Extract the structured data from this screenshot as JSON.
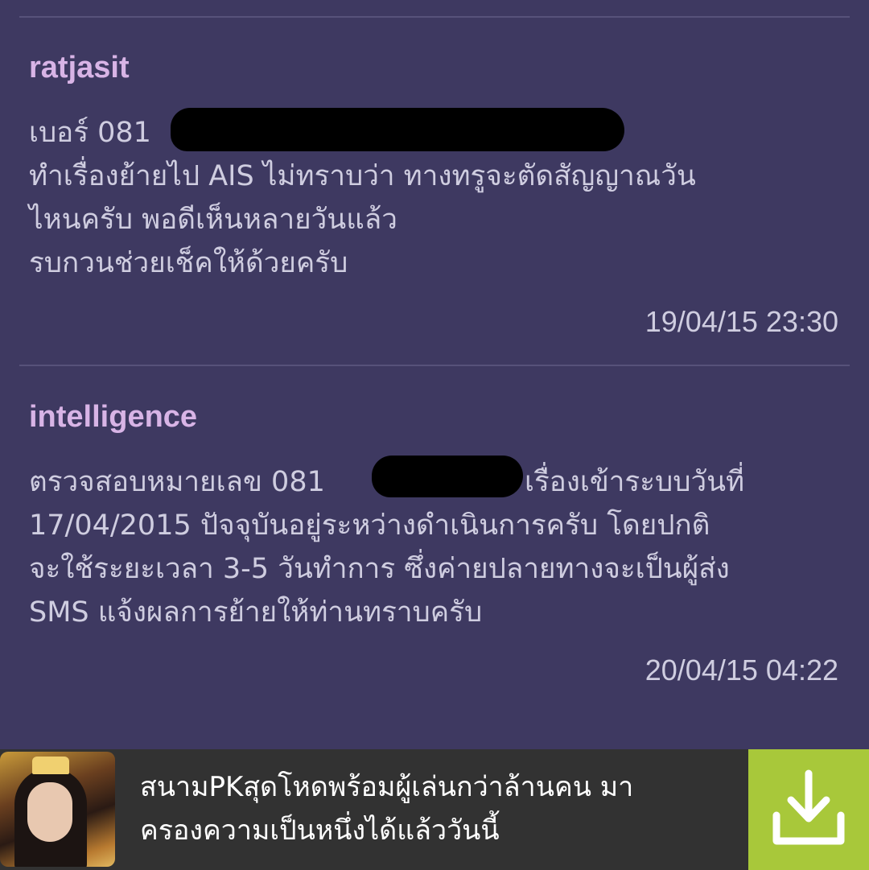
{
  "comments": [
    {
      "author": "ratjasit",
      "lines": [
        "เบอร์  081",
        "ทำเรื่องย้ายไป  AIS ไม่ทราบว่า ทางทรูจะตัดสัญญาณวัน",
        "ไหนครับ  พอดีเห็นหลายวันแล้ว",
        "รบกวนช่วยเช็คให้ด้วยครับ"
      ],
      "timestamp": "19/04/15 23:30"
    },
    {
      "author": "intelligence",
      "lines": [
        "ตรวจสอบหมายเลข 081",
        "เรื่องเข้าระบบวันที่",
        "17/04/2015 ปัจจุบันอยู่ระหว่างดำเนินการครับ โดยปกติ",
        "จะใช้ระยะเวลา 3-5 วันทำการ ซึ่งค่ายปลายทางจะเป็นผู้ส่ง",
        "SMS แจ้งผลการย้ายให้ท่านทราบครับ"
      ],
      "timestamp": "20/04/15 04:22"
    }
  ],
  "ad": {
    "line1": "สนามPKสุดโหดพร้อมผู้เล่นกว่าล้านคน มา",
    "line2": "ครองความเป็นหนึ่งได้แล้ววันนี้",
    "download_icon": "download-icon",
    "accent_color": "#a8c83a"
  },
  "colors": {
    "background": "#3e3961",
    "author": "#d8b4e6",
    "text": "#cfcde0"
  }
}
